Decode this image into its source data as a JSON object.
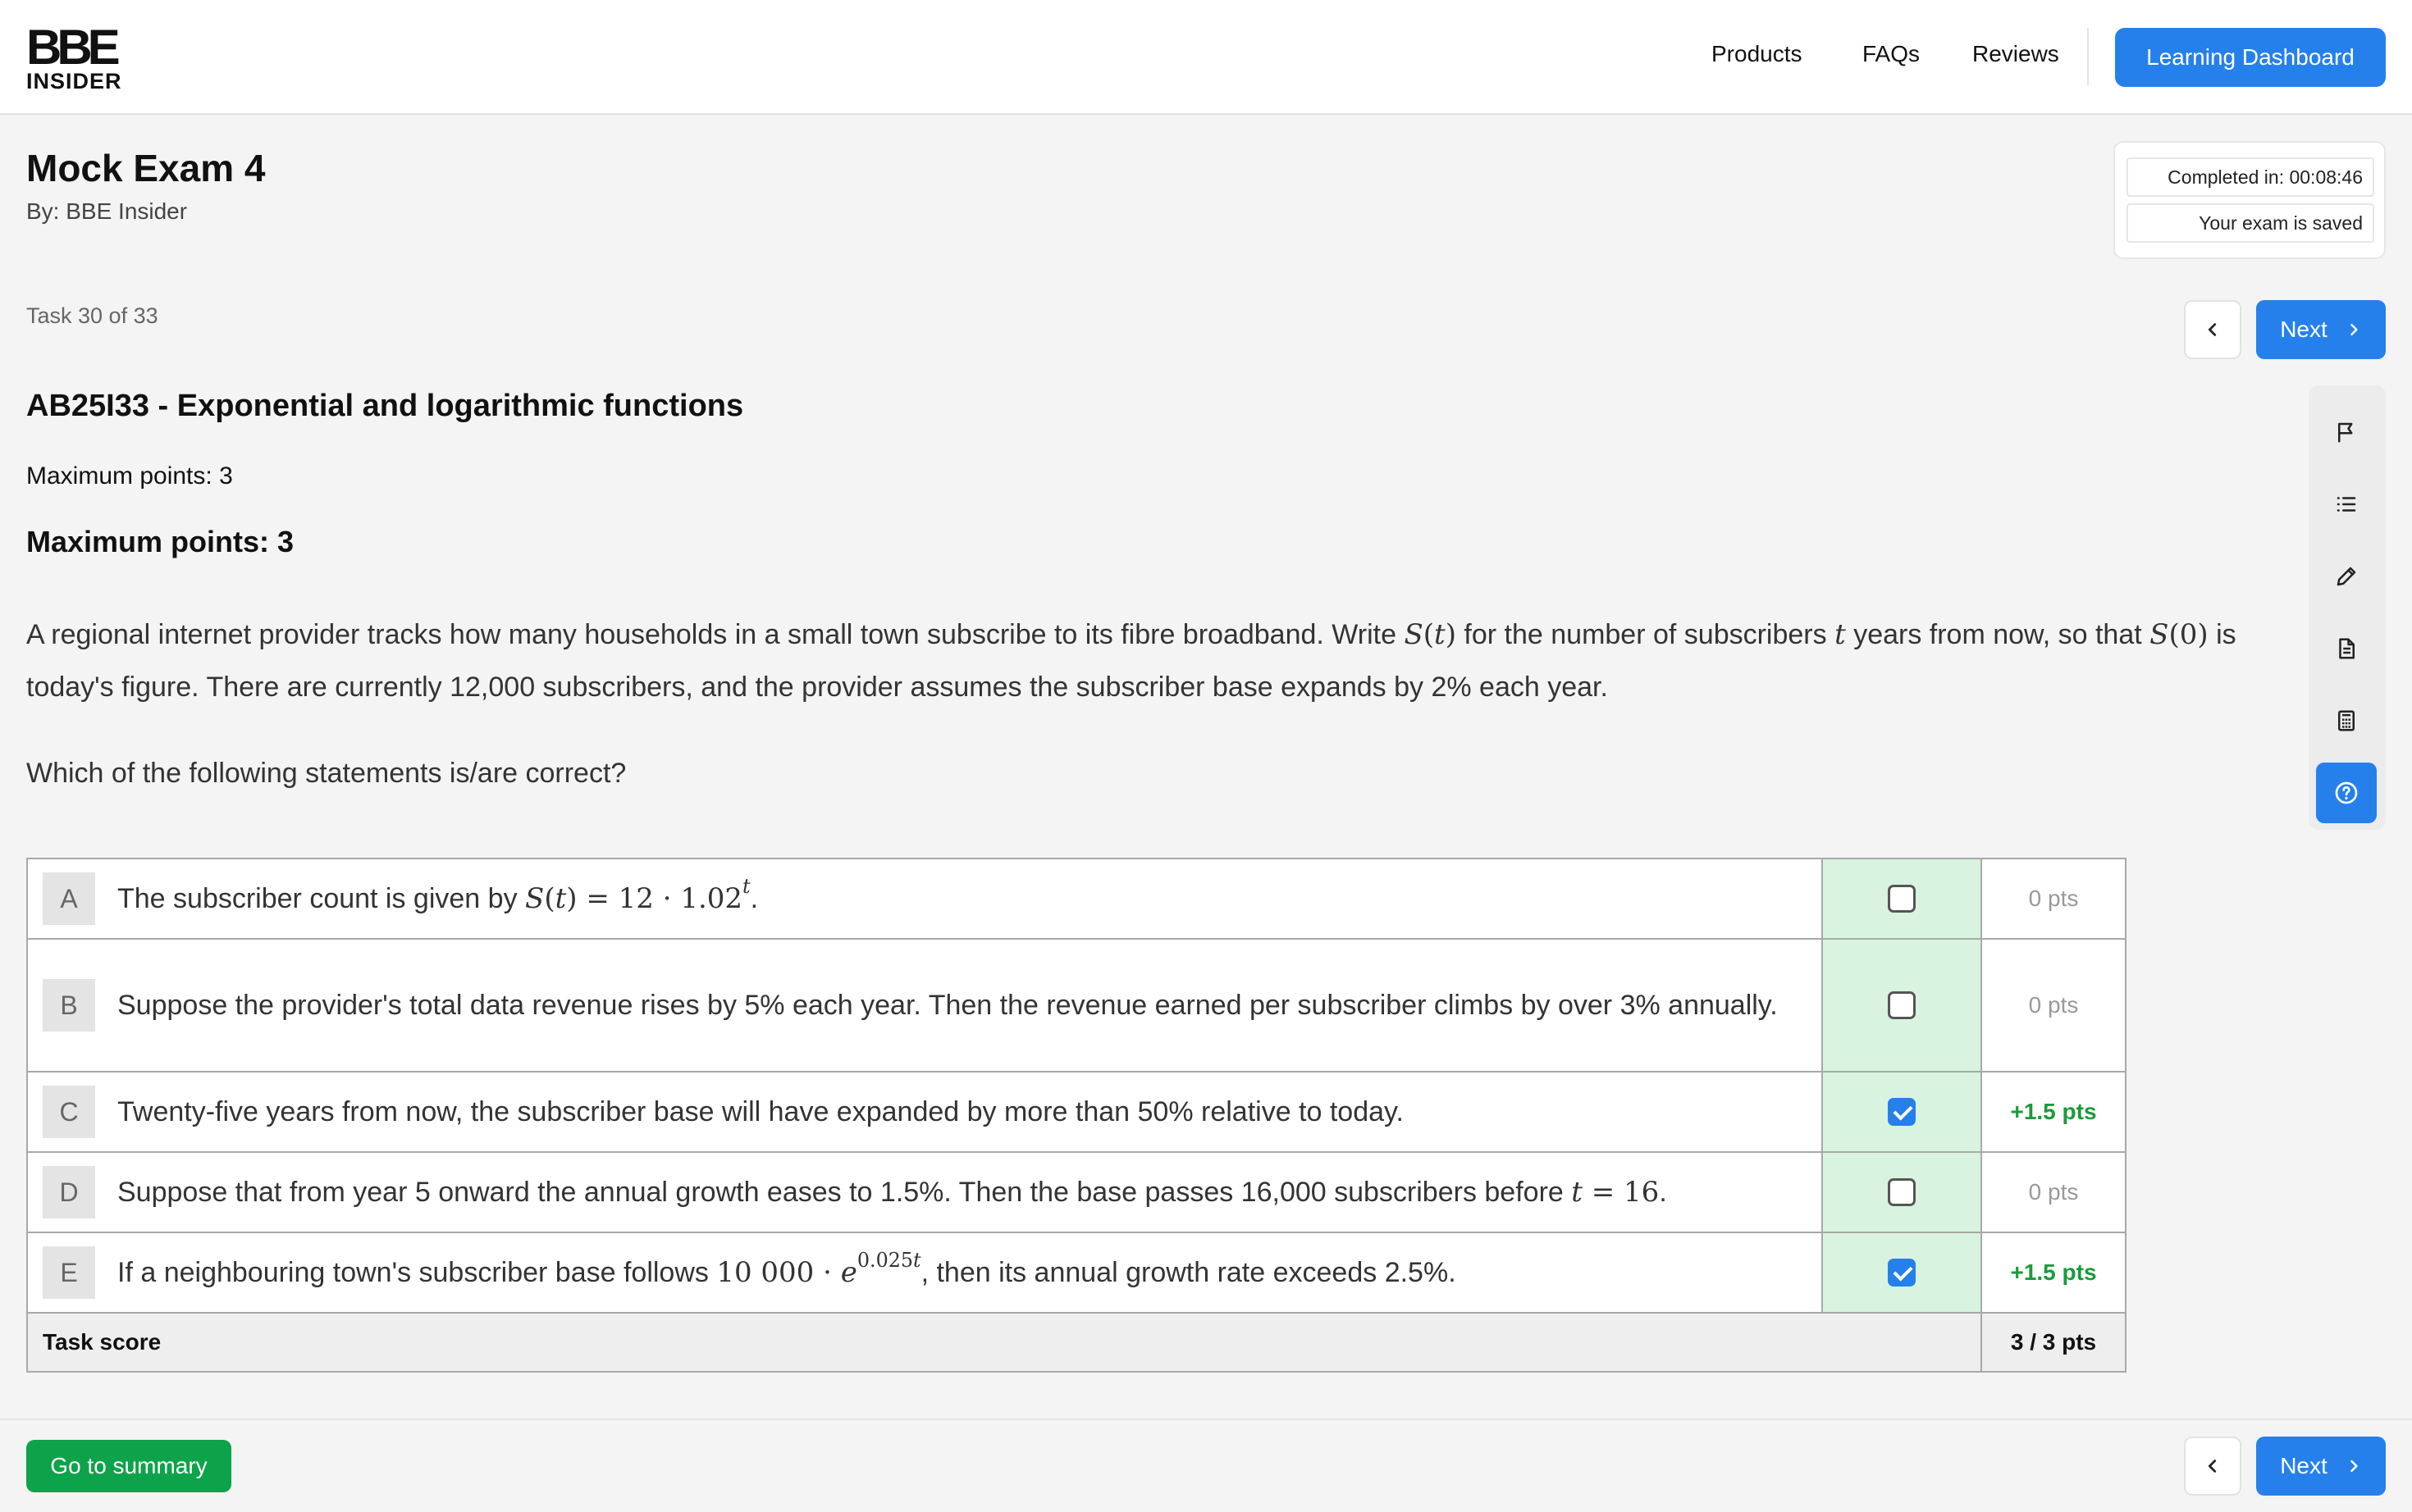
{
  "header": {
    "logo_mark": "BBE",
    "logo_sub": "INSIDER",
    "nav": [
      "Products",
      "FAQs",
      "Reviews"
    ],
    "dashboard_button": "Learning Dashboard"
  },
  "exam": {
    "title": "Mock Exam 4",
    "byline": "By: BBE Insider",
    "completed": "Completed in: 00:08:46",
    "saved": "Your exam is saved",
    "task_counter": "Task 30 of 33",
    "next_label": "Next"
  },
  "task": {
    "title": "AB25I33 - Exponential and logarithmic functions",
    "max_points_1": "Maximum points: 3",
    "max_points_2": "Maximum points: 3",
    "q_part1": "A regional internet provider tracks how many households in a small town subscribe to its fibre broadband. Write",
    "q_part2": "for the number of subscribers",
    "q_part3": "years from now, so that",
    "q_part4": "is today's figure. There are currently 12,000 subscribers, and the provider assumes the subscriber base expands by 2% each year.",
    "prompt": "Which of the following statements is/are correct?"
  },
  "options": [
    {
      "letter": "A",
      "text": "The subscriber count is given by",
      "checked": false,
      "points": "0 pts"
    },
    {
      "letter": "B",
      "text": "Suppose the provider's total data revenue rises by 5% each year. Then the revenue earned per subscriber climbs by over 3% annually.",
      "checked": false,
      "points": "0 pts"
    },
    {
      "letter": "C",
      "text": "Twenty-five years from now, the subscriber base will have expanded by more than 50% relative to today.",
      "checked": true,
      "points": "+1.5 pts"
    },
    {
      "letter": "D",
      "text": "Suppose that from year 5 onward the annual growth eases to 1.5%. Then the base passes 16,000 subscribers before",
      "checked": false,
      "points": "0 pts"
    },
    {
      "letter": "E",
      "text_before": "If a neighbouring town's subscriber base follows",
      "text_after": ", then its annual growth rate exceeds 2.5%.",
      "checked": true,
      "points": "+1.5 pts"
    }
  ],
  "score": {
    "label": "Task score",
    "value": "3 / 3 pts"
  },
  "toolbar": [
    "flag-icon",
    "list-icon",
    "pencil-icon",
    "document-icon",
    "calculator-icon",
    "help-icon"
  ],
  "footer": {
    "summary_button": "Go to summary"
  },
  "colors": {
    "accent": "#2680eb",
    "success": "#0da34a",
    "check_column": "#d8f3df",
    "points_positive": "#1c9a3c"
  }
}
